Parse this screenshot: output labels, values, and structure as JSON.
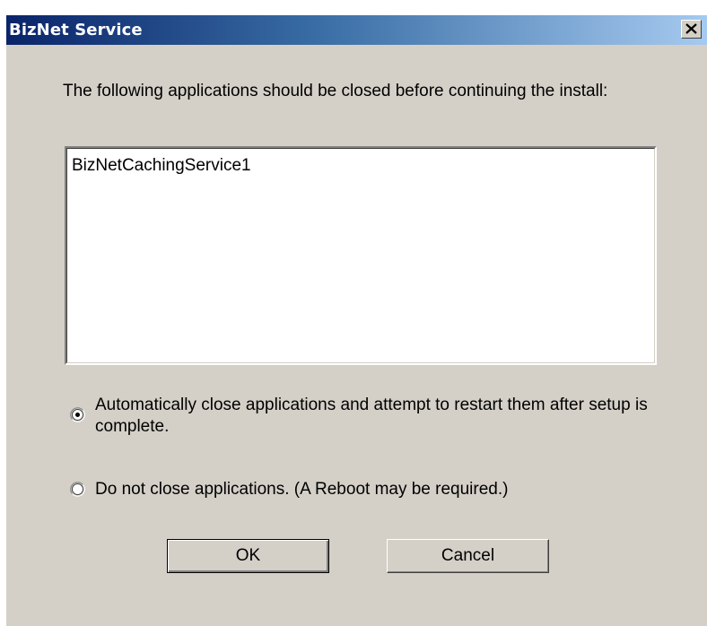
{
  "window": {
    "title": "BizNet Service"
  },
  "message": "The following applications should be closed before continuing the install:",
  "applications": [
    "BizNetCachingService1"
  ],
  "options": [
    {
      "label": "Automatically close applications and attempt to restart them after setup is complete.",
      "selected": true
    },
    {
      "label": "Do not close applications. (A Reboot may be required.)",
      "selected": false
    }
  ],
  "buttons": {
    "ok": "OK",
    "cancel": "Cancel"
  }
}
